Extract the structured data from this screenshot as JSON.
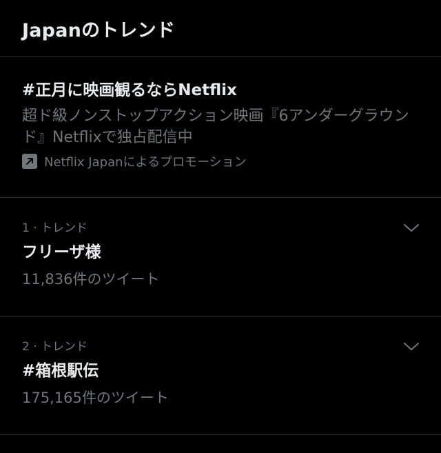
{
  "header": {
    "title": "Japanのトレンド"
  },
  "promo": {
    "title": "#正月に映画観るならNetflix",
    "description": "超ド級ノンストップアクション映画『6アンダーグラウンド』Netflixで独占配信中",
    "attribution": "Netflix Japanによるプロモーション",
    "icon": "promoted-arrow-icon"
  },
  "trends": [
    {
      "meta": "1 · トレンド",
      "name": "フリーザ様",
      "count": "11,836件のツイート",
      "icon": "chevron-down-icon"
    },
    {
      "meta": "2 · トレンド",
      "name": "#箱根駅伝",
      "count": "175,165件のツイート",
      "icon": "chevron-down-icon"
    }
  ],
  "colors": {
    "background": "#000000",
    "primary_text": "#e7e9ea",
    "secondary_text": "#71767b",
    "divider": "#2f3336"
  }
}
